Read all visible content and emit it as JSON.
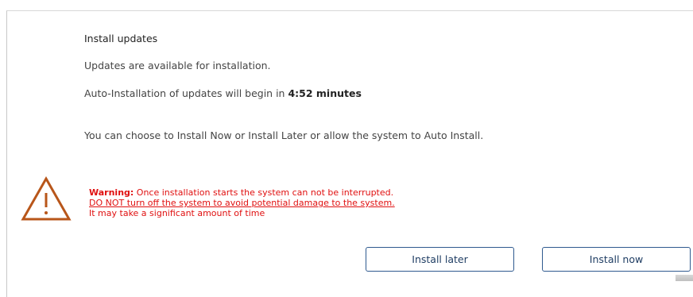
{
  "dialog": {
    "title": "Install updates",
    "available_text": "Updates are available for installation.",
    "auto_install_prefix": "Auto-Installation of updates will begin in ",
    "countdown": "4:52 minutes",
    "choice_text": "You can choose to Install Now or Install Later or allow the system to Auto Install."
  },
  "warning": {
    "label": "Warning:",
    "line1": " Once installation starts the system can not be interrupted.",
    "line2": "DO NOT turn off the system to avoid potential damage to the system.",
    "line3": "It may take a significant amount of time",
    "icon": "warning-triangle-icon",
    "color": "#e01010",
    "icon_color": "#b8561a"
  },
  "buttons": {
    "install_later": "Install later",
    "install_now": "Install now"
  },
  "colors": {
    "button_border": "#2f5a8f",
    "button_text": "#1f3d63",
    "background_banner": "#1a7fd0"
  }
}
